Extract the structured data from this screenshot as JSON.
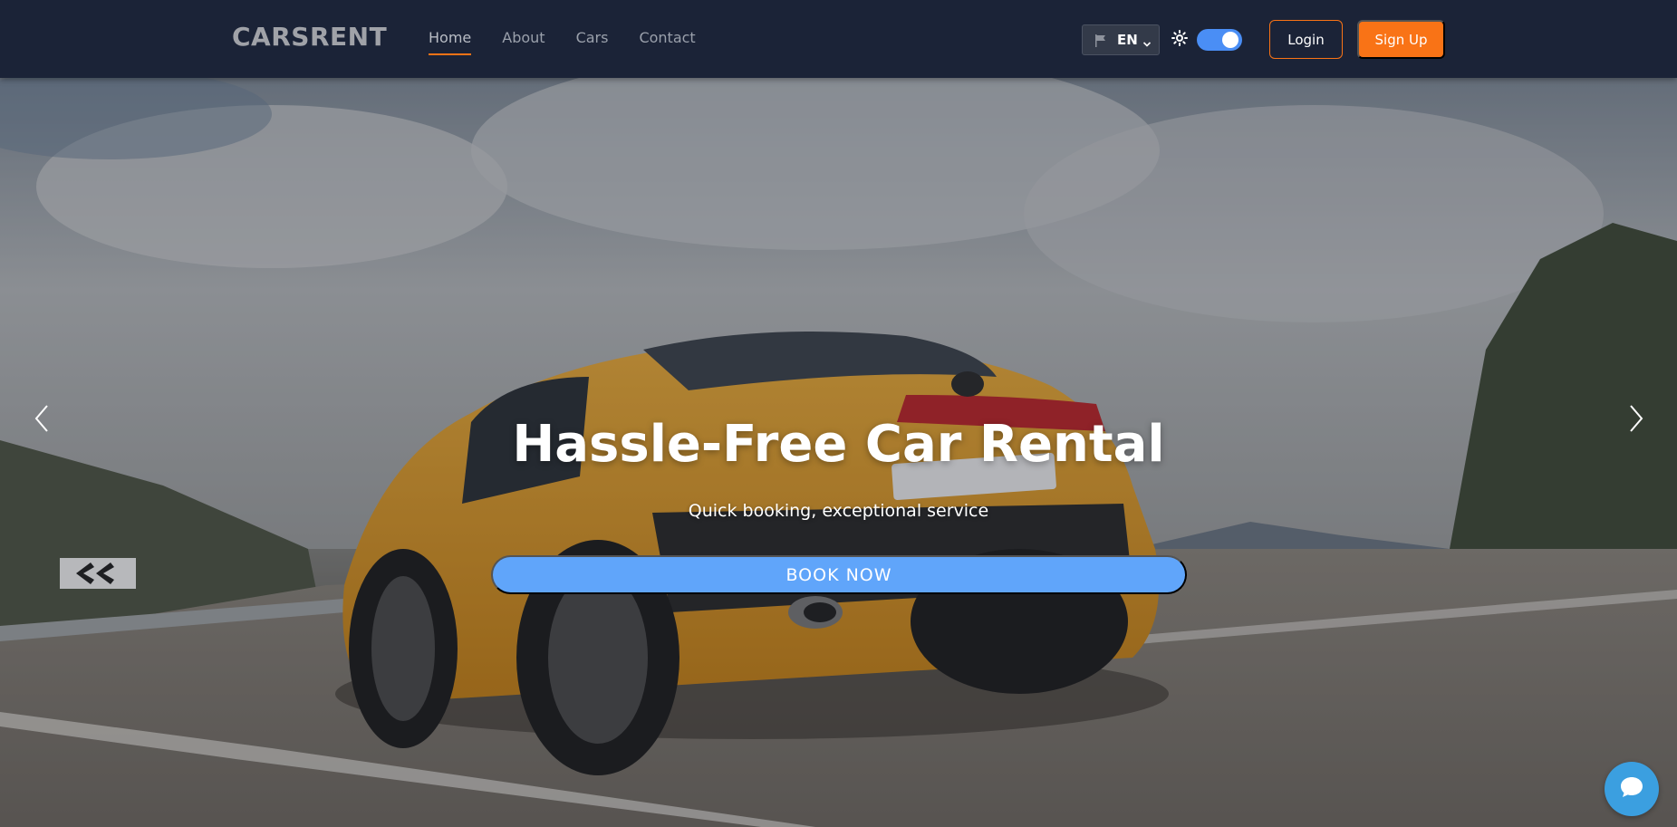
{
  "brand": {
    "logo_text": "CARSRENT"
  },
  "nav": {
    "links": [
      {
        "label": "Home",
        "active": true
      },
      {
        "label": "About",
        "active": false
      },
      {
        "label": "Cars",
        "active": false
      },
      {
        "label": "Contact",
        "active": false
      }
    ]
  },
  "language": {
    "selected": "EN",
    "icon": "flag-icon"
  },
  "theme": {
    "icon": "sun-icon",
    "toggle_on": true
  },
  "auth": {
    "login_label": "Login",
    "signup_label": "Sign Up"
  },
  "hero": {
    "title": "Hassle-Free Car Rental",
    "subtitle": "Quick booking, exceptional service",
    "cta_label": "BOOK NOW",
    "prev_icon": "chevron-left-icon",
    "next_icon": "chevron-right-icon"
  },
  "chat": {
    "icon": "chat-bubble-icon"
  },
  "colors": {
    "navbar_bg": "#1b2337",
    "accent": "#f97316",
    "cta": "#60a5fa",
    "toggle": "#4a8ef5",
    "chat": "#3b9fe0"
  }
}
